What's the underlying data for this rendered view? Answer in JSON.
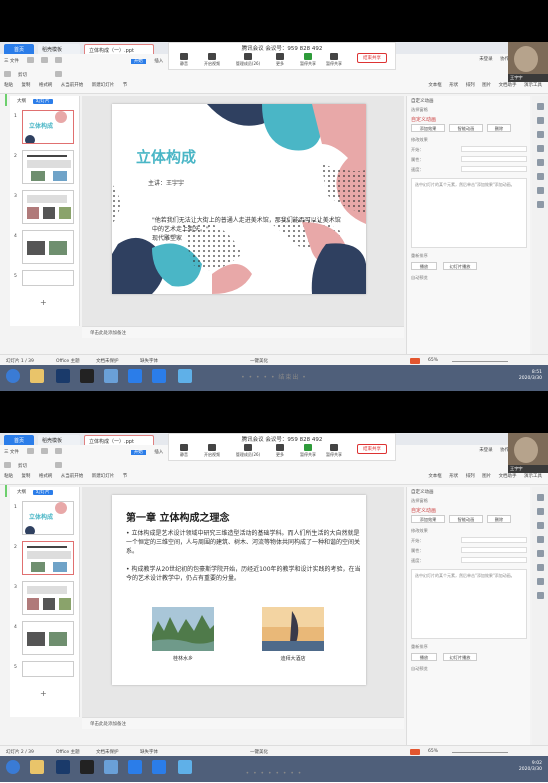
{
  "meeting": {
    "title": "腾讯会议 会议号：959 828 492",
    "buttons": [
      "静音",
      "开启视频",
      "管理成员(26)",
      "更多",
      "暂停共享",
      "暂停共享"
    ],
    "end_label": "结束共享"
  },
  "tabs": {
    "home": "首页",
    "t2": "稻壳模板",
    "t3": "立体构成（一）.ppt"
  },
  "ribbon": {
    "row1": [
      "三 文件",
      "开始",
      "插入"
    ],
    "row2": [
      "剪切",
      "粘贴",
      "从当前开始",
      "新建幻灯片",
      "版式",
      "重置"
    ],
    "row3": [
      "粘贴",
      "复制",
      "格式刷",
      "从当前开始",
      "新建幻灯片",
      "节"
    ],
    "right_top": [
      "未登录",
      "协作",
      "分享",
      "批注"
    ],
    "right_mid": [
      "查找",
      "替换",
      "文本框",
      "形状",
      "排列",
      "图片",
      "文档助手",
      "演示工具"
    ]
  },
  "camera": {
    "name": "王宇宇"
  },
  "left_pane": {
    "tabs": [
      "大纲",
      "幻灯片"
    ]
  },
  "notes_placeholder": "单击此处添加备注",
  "right_pane": {
    "title": "自定义动画",
    "select_pane": "选择窗格",
    "section": "自定义动画",
    "add_effect": "添加效果",
    "smart_effect": "智能动画",
    "delete": "删除",
    "modify_label": "修改效果",
    "start": "开始：",
    "property": "属性：",
    "speed": "速度：",
    "box_text": "选中幻灯片的某个元素，然后单击\"添加效果\"添加动画。",
    "reorder": "重新排序",
    "play": "播放",
    "slideshow": "幻灯片播放",
    "autopreview": "自动预览"
  },
  "frame1": {
    "slide": {
      "title": "立体构成",
      "presenter": "主讲：王宇宇",
      "quote": "\"他若我们无法让大街上的普通人走进美术馆，那我们能否可以让美术馆中的艺术走上街头。\"",
      "quote_author": "现代雕塑家"
    },
    "status": {
      "slide_no": "幻灯片 1 / 39",
      "theme": "Office 主题",
      "protect": "文档未保护",
      "font": "缺失字体",
      "beautify": "一键美化",
      "zoom": "65%"
    },
    "clock": {
      "time": "8:51",
      "date": "2020/3/30"
    },
    "overlay_dots": "• • • • • 结束出 •"
  },
  "frame2": {
    "slide": {
      "title": "第一章 立体构成之理念",
      "para1": "• 立体构成是艺术设计领域中研究三维造型活动的基础学科。而人们所生活的大自然就是一个恒定的三维空间，人与周围的建筑、树木、河流等物体共同构成了一种和谐的空间关系。",
      "para2": "• 构成教学从20世纪初的包豪斯学院开始，历经近100年的教学和设计实践的考验，在当今的艺术设计教学中，仍占有重要的分量。",
      "cap1": "桂林水乡",
      "cap2": "迪拜大酒店"
    },
    "status": {
      "slide_no": "幻灯片 2 / 39",
      "theme": "Office 主题",
      "protect": "文档未保护",
      "font": "缺失字体",
      "beautify": "一键美化",
      "zoom": "65%"
    },
    "clock": {
      "time": "9:02",
      "date": "2020/3/30"
    },
    "overlay_dots": "• • • • • • • •"
  },
  "colors": {
    "accent": "#2b7de9",
    "teal": "#4ab6c6",
    "pink": "#e8a8a8",
    "navy": "#2f4060",
    "taskbar": "#4f5f7a"
  }
}
